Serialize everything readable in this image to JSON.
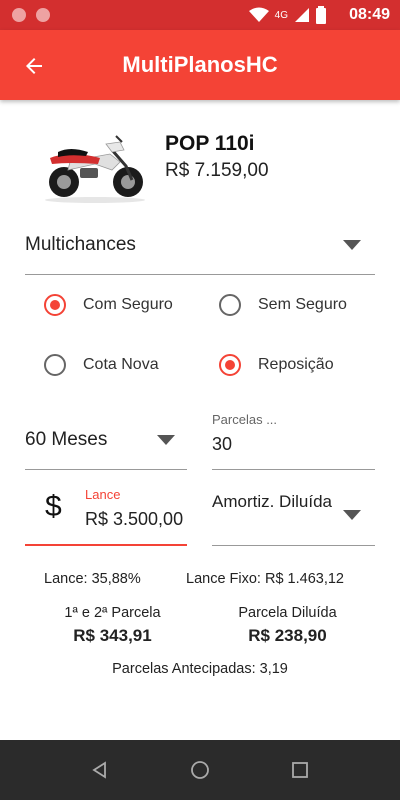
{
  "status_bar": {
    "network": "4G",
    "time": "08:49"
  },
  "app_bar": {
    "title": "MultiPlanosHC"
  },
  "product": {
    "name": "POP 110i",
    "price": "R$ 7.159,00"
  },
  "plan": {
    "selected": "Multichances"
  },
  "insurance": {
    "with_label": "Com Seguro",
    "with_selected": true,
    "without_label": "Sem Seguro",
    "without_selected": false
  },
  "quota": {
    "new_label": "Cota Nova",
    "new_selected": false,
    "replacement_label": "Reposição",
    "replacement_selected": true
  },
  "term": {
    "selected": "60 Meses"
  },
  "installments": {
    "label": "Parcelas ...",
    "value": "30"
  },
  "bid": {
    "label": "Lance",
    "value": "R$ 3.500,00"
  },
  "amortization": {
    "selected": "Amortiz. Diluída"
  },
  "summary": {
    "bid_percent": "Lance: 35,88%",
    "fixed_bid": "Lance Fixo: R$ 1.463,12",
    "first_second_label": "1ª e 2ª Parcela",
    "first_second_value": "R$ 343,91",
    "diluted_label": "Parcela Diluída",
    "diluted_value": "R$ 238,90",
    "anticipated": "Parcelas Antecipadas: 3,19"
  },
  "colors": {
    "primary": "#f44336",
    "primary_dark": "#d32f2f",
    "navbar": "#2b2b2b"
  }
}
